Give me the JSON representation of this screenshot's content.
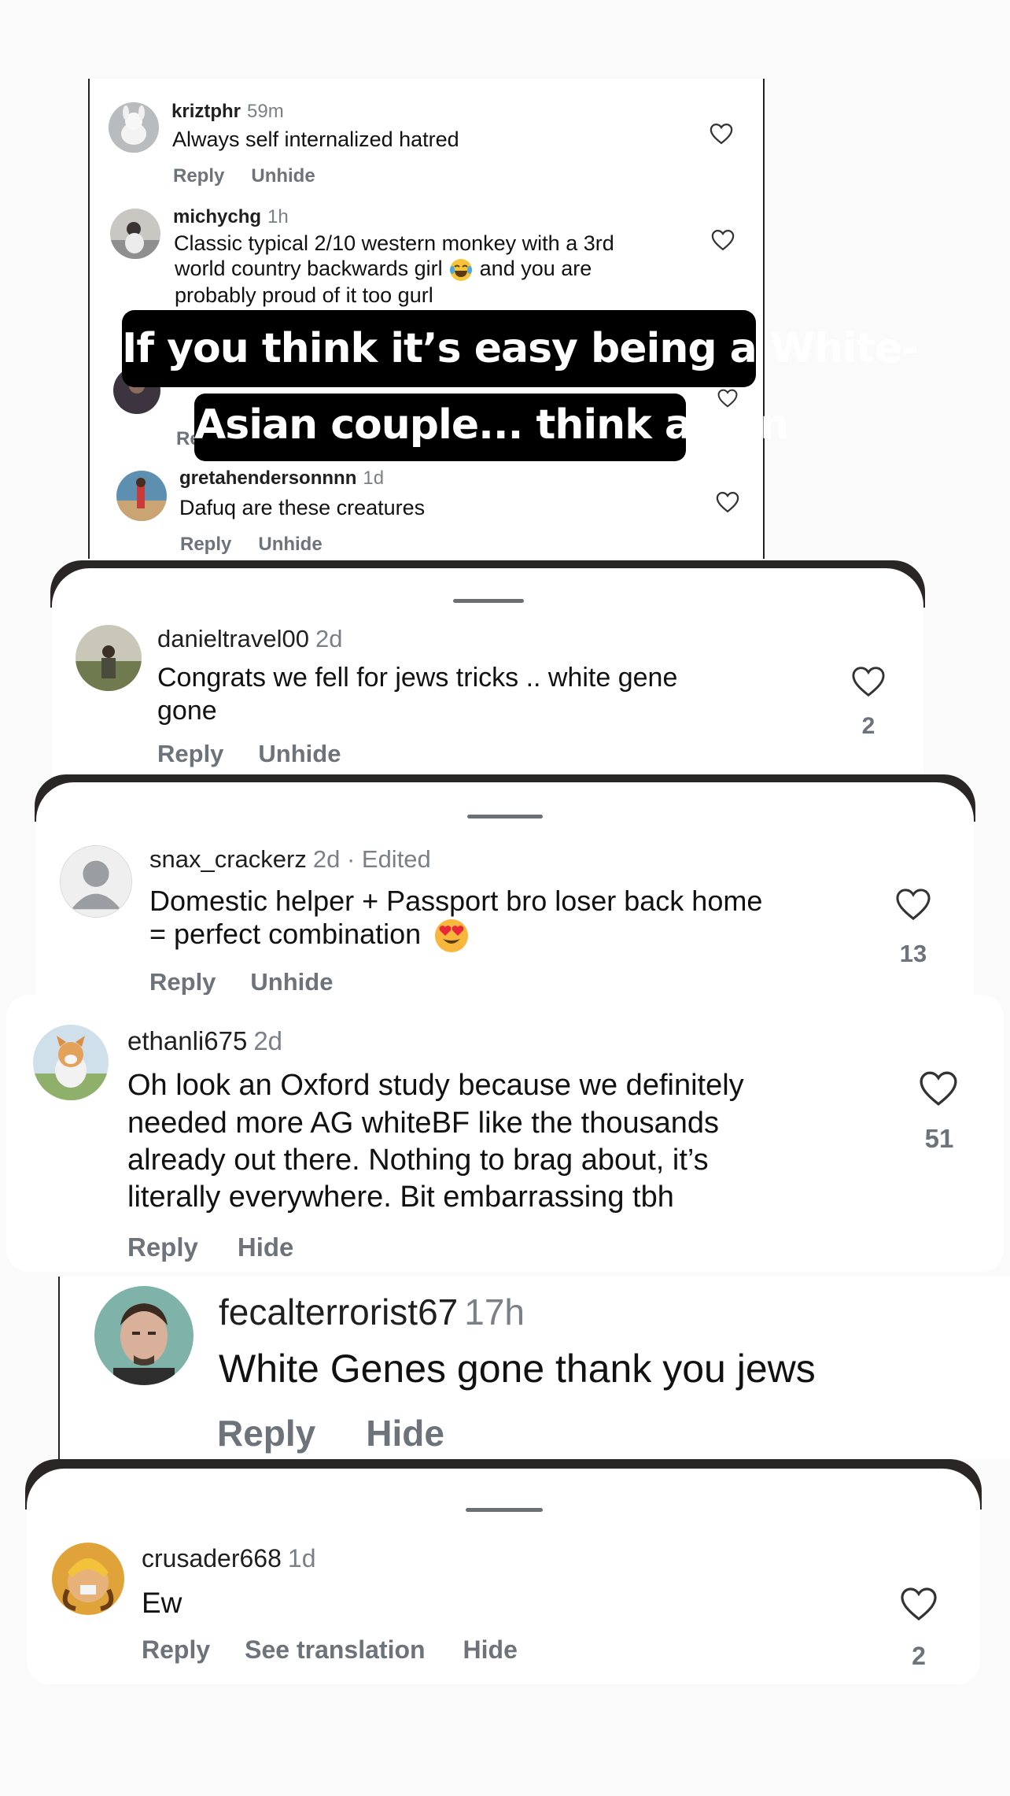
{
  "caption": {
    "line1": "If you think it’s easy being a White-",
    "line2": "Asian couple... think again"
  },
  "comments": [
    {
      "username": "kriztphr",
      "time": "59m",
      "text": "Always self internalized hatred",
      "reply": "Reply",
      "action": "Unhide"
    },
    {
      "username": "michychg",
      "time": "1h",
      "text_line1": "Classic typical 2/10 western monkey with a 3rd",
      "text_line2a": "world country backwards girl",
      "text_line2b": "and you are",
      "text_line3": "probably proud of it too gurl"
    },
    {
      "reply_partial": "Re"
    },
    {
      "username": "gretahendersonnnn",
      "time": "1d",
      "text": "Dafuq are these creatures",
      "reply": "Reply",
      "action": "Unhide"
    },
    {
      "username": "danieltravel00",
      "time": "2d",
      "text_line1": "Congrats we fell for jews tricks .. white gene",
      "text_line2": "gone",
      "reply": "Reply",
      "action": "Unhide",
      "likes": "2"
    },
    {
      "username": "snax_crackerz",
      "time": "2d · Edited",
      "text_line1": "Domestic helper + Passport bro loser back home",
      "text_line2": "= perfect combination",
      "reply": "Reply",
      "action": "Unhide",
      "likes": "13"
    },
    {
      "username": "ethanli675",
      "time": "2d",
      "text_line1": "Oh look an Oxford study because we definitely",
      "text_line2": "needed more AG whiteBF like the thousands",
      "text_line3": "already out there. Nothing to brag about, it’s",
      "text_line4": "literally everywhere. Bit embarrassing tbh",
      "reply": "Reply",
      "action": "Hide",
      "likes": "51"
    },
    {
      "username": "fecalterrorist67",
      "time": "17h",
      "text": "White Genes gone thank you jews",
      "reply": "Reply",
      "action": "Hide"
    },
    {
      "username": "crusader668",
      "time": "1d",
      "text": "Ew",
      "reply": "Reply",
      "translate": "See translation",
      "action": "Hide",
      "likes": "2"
    }
  ],
  "colors": {
    "background": "#fafafa",
    "card": "#ffffff",
    "muted": "#6d737a",
    "caption_bg": "#000000",
    "caption_fg": "#ffffff"
  },
  "icons": [
    "heart-outline-icon",
    "laughing-tears-emoji",
    "heart-eyes-emoji",
    "default-avatar-icon"
  ]
}
